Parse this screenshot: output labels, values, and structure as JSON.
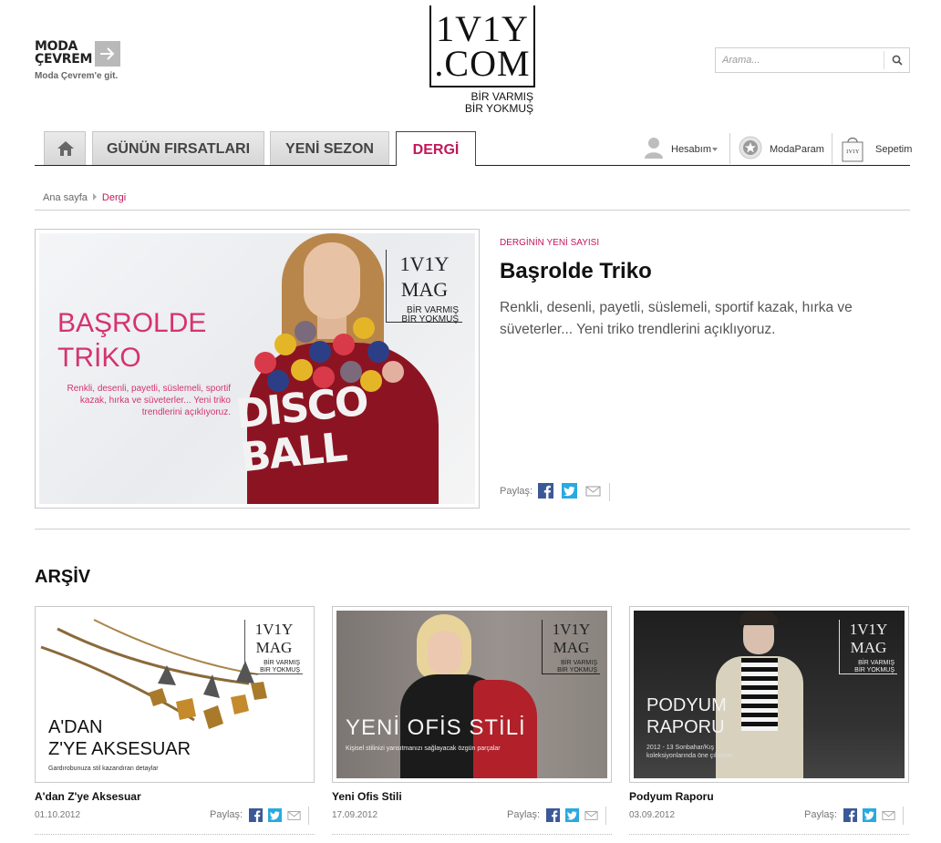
{
  "header": {
    "moda_cevrem_line1": "MODA",
    "moda_cevrem_line2": "ÇEVREM",
    "moda_cevrem_link": "Moda Çevrem'e git.",
    "logo_line1": "1V1Y",
    "logo_line2": ".COM",
    "logo_tagline_1": "BİR VARMIŞ",
    "logo_tagline_2": "BİR YOKMUŞ",
    "search_placeholder": "Arama..."
  },
  "nav": {
    "tabs": [
      {
        "label": "GÜNÜN FIRSATLARI"
      },
      {
        "label": "YENİ SEZON"
      },
      {
        "label": "DERGİ"
      }
    ],
    "account": "Hesabım",
    "modaparam": "ModaParam",
    "cart": "Sepetim"
  },
  "breadcrumb": {
    "home": "Ana sayfa",
    "current": "Dergi"
  },
  "feature": {
    "label": "DERGİNİN YENİ SAYISI",
    "heading": "Başrolde Triko",
    "description": "Renkli, desenli, payetli, süslemeli, sportif kazak, hırka ve süveterler... Yeni triko trendlerini açıklıyoruz.",
    "share_label": "Paylaş:",
    "image": {
      "badge_line1": "1V1Y",
      "badge_line2": "MAG",
      "badge_tag1": "BİR VARMIŞ",
      "badge_tag2": "BİR YOKMUŞ",
      "title_line1": "BAŞROLDE",
      "title_line2": "TRİKO",
      "subtitle": "Renkli, desenli, payetli, süslemeli, sportif kazak, hırka ve süveterler... Yeni triko trendlerini açıklıyoruz.",
      "sweater_line1": "DISCO",
      "sweater_line2": "BALL"
    }
  },
  "archive": {
    "heading": "ARŞİV",
    "share_label": "Paylaş:",
    "items": [
      {
        "title": "A'dan Z'ye Aksesuar",
        "date": "01.10.2012",
        "art_line1": "A'DAN",
        "art_line2": "Z'YE AKSESUAR",
        "art_sub": "Gardırobunuza stil kazandıran detaylar"
      },
      {
        "title": "Yeni Ofis Stili",
        "date": "17.09.2012",
        "art_line1": "YENİ OFİS STİLİ",
        "art_sub": "Kişisel stilinizi yansıtmanızı sağlayacak özgün parçalar"
      },
      {
        "title": "Podyum Raporu",
        "date": "03.09.2012",
        "art_line1": "PODYUM",
        "art_line2": "RAPORU",
        "art_sub": "2012 - 13 Sonbahar/Kış koleksiyonlarında öne çıkanlar"
      }
    ]
  },
  "colors": {
    "accent": "#c2185b",
    "facebook": "#3b5998",
    "twitter": "#29a9e1"
  },
  "icons": [
    "arrow-right-icon",
    "search-icon",
    "home-icon",
    "user-icon",
    "star-badge-icon",
    "shopping-bag-icon",
    "facebook-icon",
    "twitter-icon",
    "mail-icon"
  ]
}
